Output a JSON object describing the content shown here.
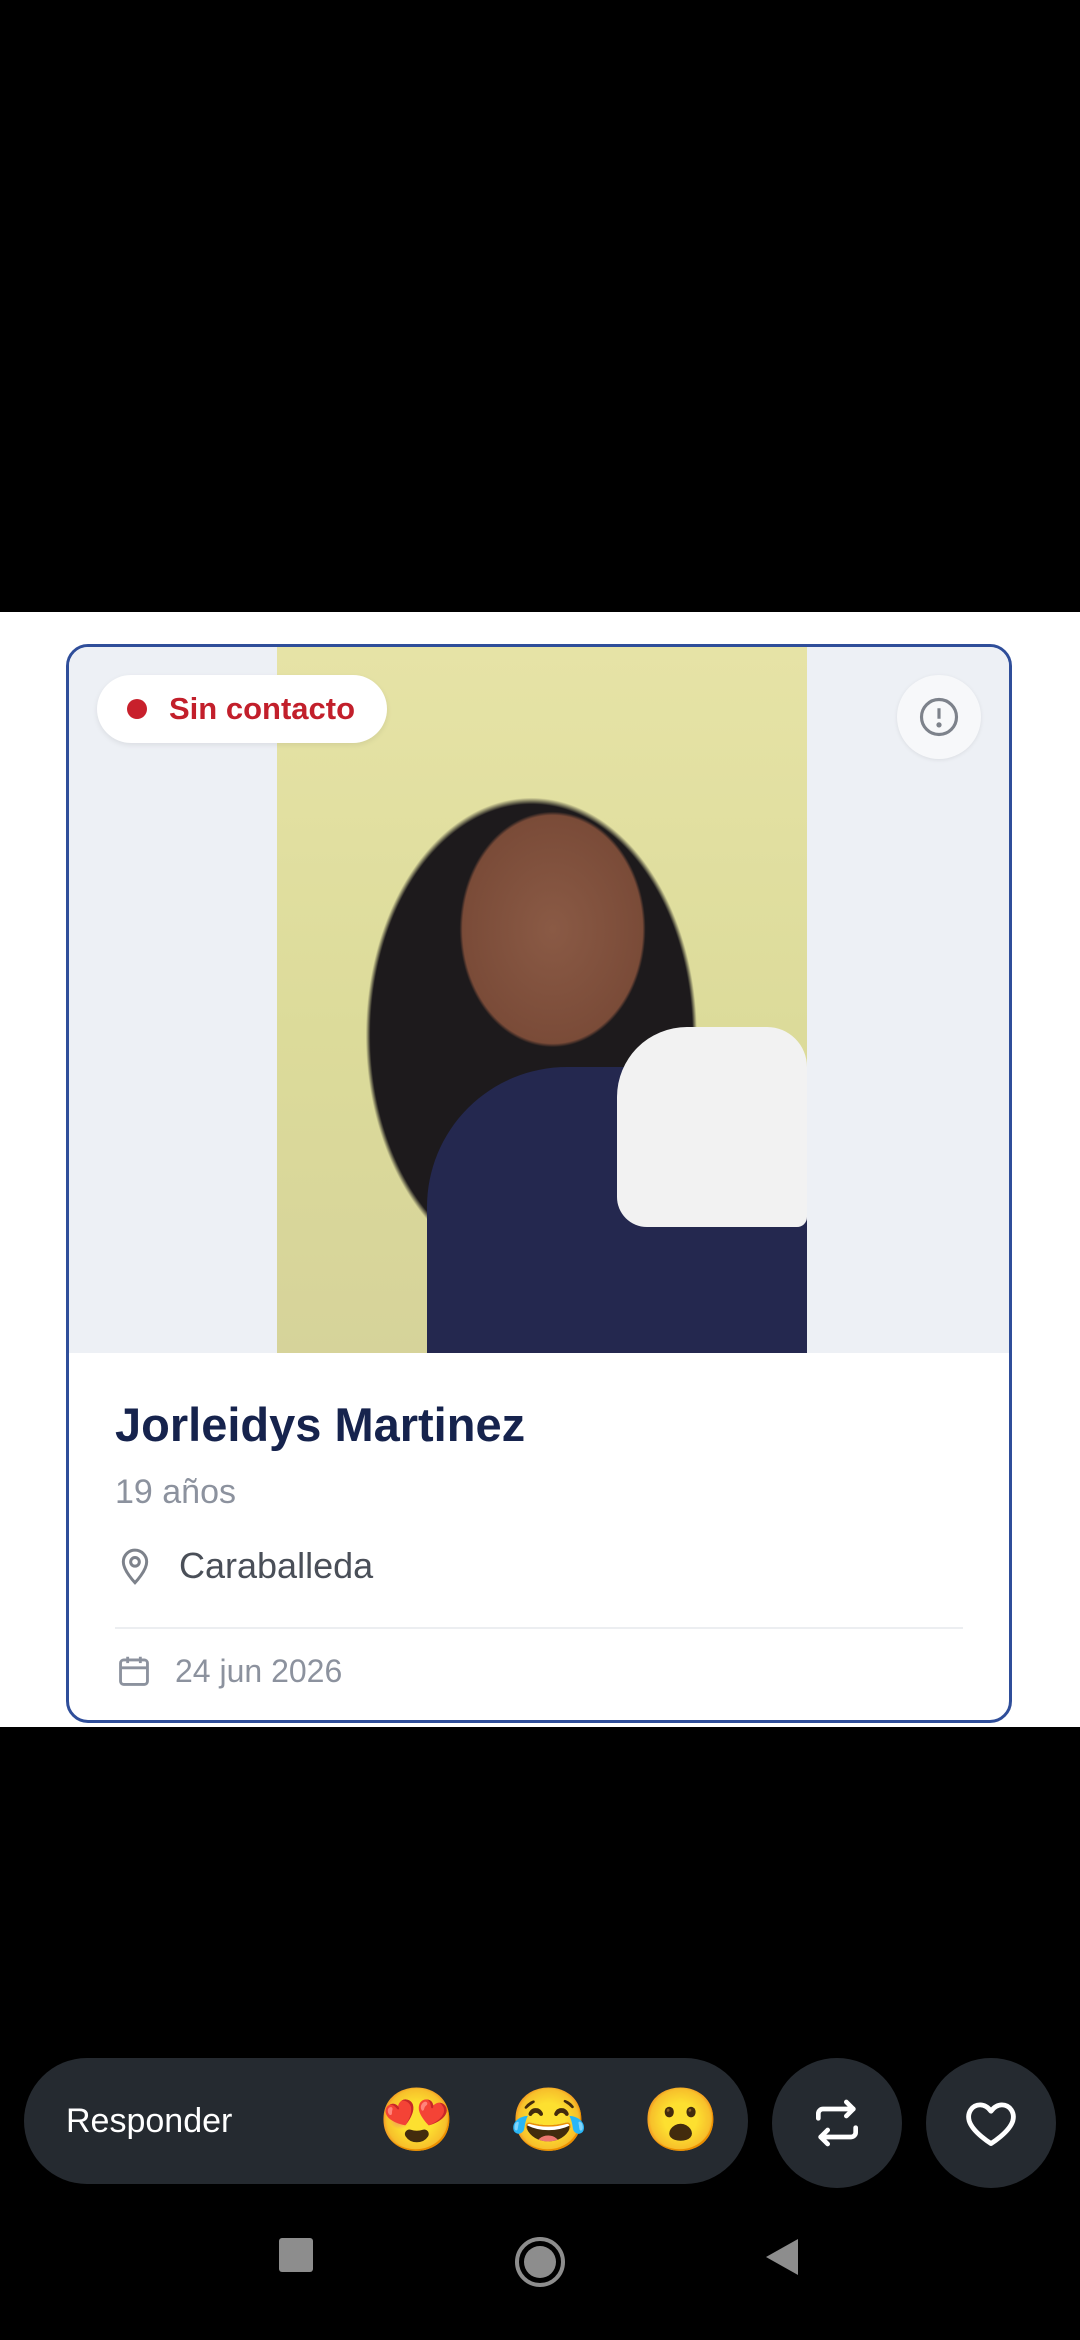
{
  "post": {
    "status_badge": "Sin contacto",
    "person_name": "Jorleidys Martinez",
    "age": "19 años",
    "location": "Caraballeda",
    "date": "24 jun 2026"
  },
  "reply_bar": {
    "placeholder": "Responder",
    "emojis": [
      "😍",
      "😂",
      "😮"
    ]
  },
  "icons": {
    "status": "status-dot-icon",
    "info": "alert-circle-icon",
    "location": "map-pin-icon",
    "date": "calendar-icon",
    "repost": "repost-icon",
    "like": "heart-icon",
    "nav_recents": "square-icon",
    "nav_home": "circle-icon",
    "nav_back": "triangle-back-icon"
  },
  "colors": {
    "status_red": "#c21f2b",
    "card_border": "#2f4e9a",
    "name_navy": "#16234d"
  }
}
